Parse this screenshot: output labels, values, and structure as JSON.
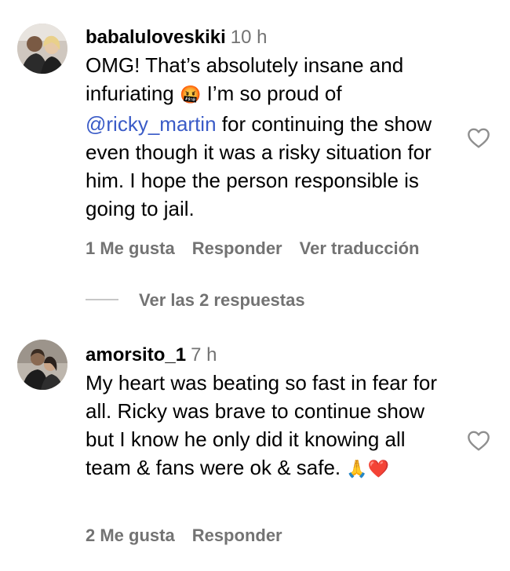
{
  "comments": [
    {
      "username": "babaluloveskiki",
      "time": "10 h",
      "text_before": "OMG! That’s absolutely insane and infuriating ",
      "emoji": "🤬",
      "text_mid": " I’m so proud of ",
      "mention": "@ricky_martin",
      "text_after": " for continuing the show even though it was a risky situation for him. I hope the person responsible is going to jail.",
      "likes": "1 Me gusta",
      "reply": "Responder",
      "translate": "Ver traducción",
      "like_icon": "heart-outline-icon"
    },
    {
      "username": "amorsito_1",
      "time": "7 h",
      "text": "My heart was beating so fast in fear for all. Ricky was brave to continue show but I know he only did it knowing all team & fans were ok & safe. ",
      "emoji": "🙏❤️",
      "likes": "2 Me gusta",
      "reply": "Responder",
      "like_icon": "heart-outline-icon"
    }
  ],
  "view_replies": "Ver las 2 respuestas"
}
